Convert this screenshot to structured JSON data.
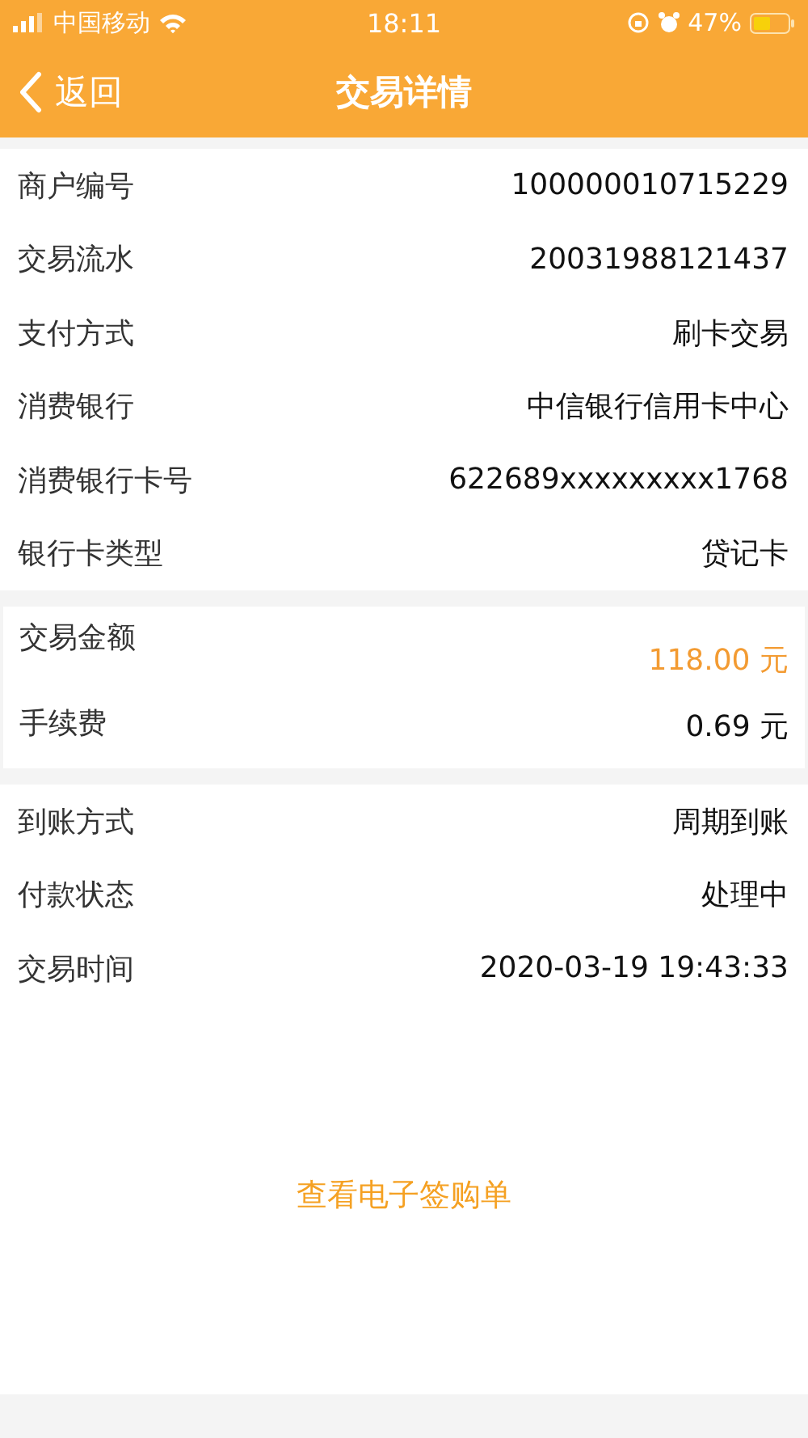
{
  "status_bar": {
    "carrier": "中国移动",
    "time": "18:11",
    "battery": "47%"
  },
  "nav": {
    "back": "返回",
    "title": "交易详情"
  },
  "sections": [
    {
      "kind": "plain",
      "rows": [
        {
          "label": "商户编号",
          "value": "100000010715229",
          "highlight": false
        },
        {
          "label": "交易流水",
          "value": "20031988121437",
          "highlight": false
        },
        {
          "label": "支付方式",
          "value": "刷卡交易",
          "highlight": false
        },
        {
          "label": "消费银行",
          "value": "中信银行信用卡中心",
          "highlight": false
        },
        {
          "label": "消费银行卡号",
          "value": "622689xxxxxxxxx1768",
          "highlight": false
        },
        {
          "label": "银行卡类型",
          "value": "贷记卡",
          "highlight": false
        }
      ]
    },
    {
      "kind": "amount",
      "rows": [
        {
          "label": "交易金额",
          "value": "118.00 元",
          "highlight": true
        },
        {
          "label": "手续费",
          "value": "0.69 元",
          "highlight": false
        }
      ]
    },
    {
      "kind": "plain",
      "rows": [
        {
          "label": "到账方式",
          "value": "周期到账",
          "highlight": false
        },
        {
          "label": "付款状态",
          "value": "处理中",
          "highlight": false
        },
        {
          "label": "交易时间",
          "value": "2020-03-19 19:43:33",
          "highlight": false
        }
      ]
    }
  ],
  "link": "查看电子签购单"
}
